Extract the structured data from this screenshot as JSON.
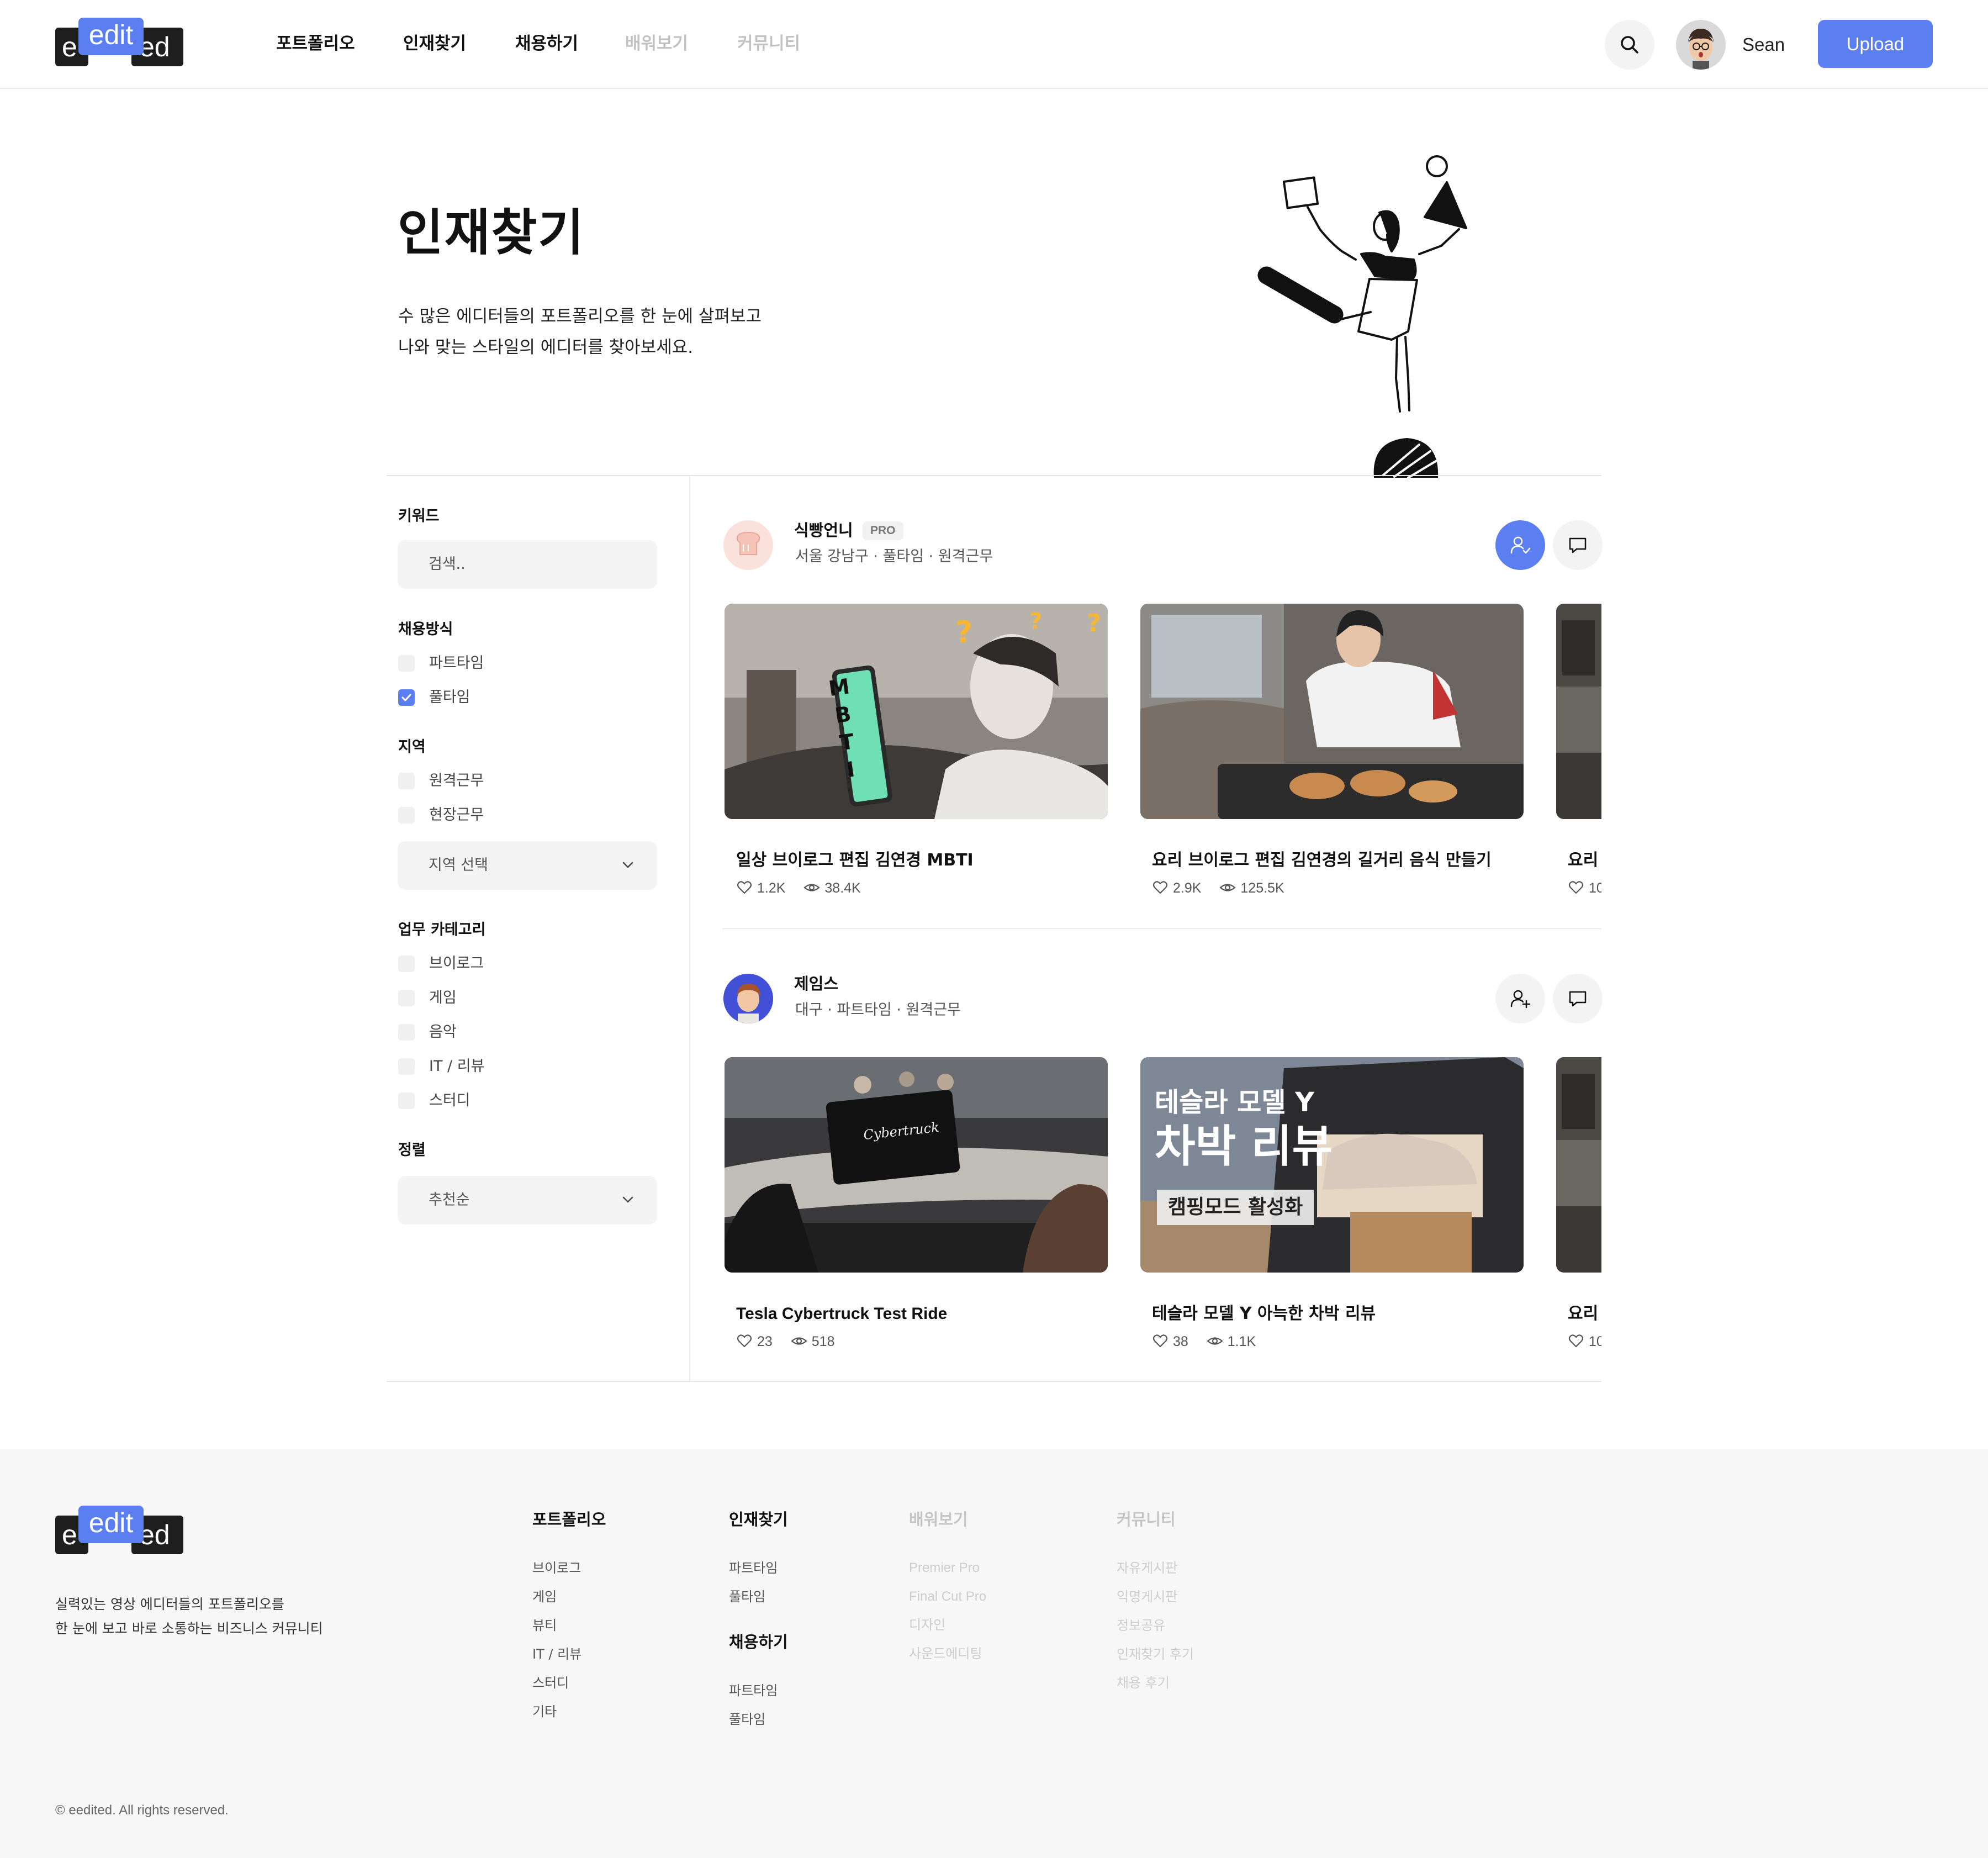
{
  "brand": {
    "logo_left": "e",
    "logo_mid": "edit",
    "logo_right": "ed"
  },
  "nav": {
    "items": [
      {
        "label": "포트폴리오"
      },
      {
        "label": "인재찾기"
      },
      {
        "label": "채용하기"
      },
      {
        "label": "배워보기",
        "disabled": true
      },
      {
        "label": "커뮤니티",
        "disabled": true
      }
    ]
  },
  "header": {
    "search_icon": "search-icon",
    "user_name": "Sean",
    "upload_label": "Upload"
  },
  "hero": {
    "title": "인재찾기",
    "desc_line1": "수 많은 에디터들의 포트폴리오를 한 눈에 살펴보고",
    "desc_line2": "나와 맞는 스타일의 에디터를 찾아보세요."
  },
  "filters": {
    "keyword_label": "키워드",
    "search_placeholder": "검색..",
    "hire_type_label": "채용방식",
    "hire_types": [
      {
        "label": "파트타임",
        "checked": false
      },
      {
        "label": "풀타임",
        "checked": true
      }
    ],
    "region_label": "지역",
    "regions": [
      {
        "label": "원격근무",
        "checked": false
      },
      {
        "label": "현장근무",
        "checked": false
      }
    ],
    "region_select": "지역 선택",
    "category_label": "업무 카테고리",
    "categories": [
      {
        "label": "브이로그",
        "checked": false
      },
      {
        "label": "게임",
        "checked": false
      },
      {
        "label": "음악",
        "checked": false
      },
      {
        "label": "IT / 리뷰",
        "checked": false
      },
      {
        "label": "스터디",
        "checked": false
      }
    ],
    "sort_label": "정렬",
    "sort_select": "추천순"
  },
  "editors": [
    {
      "name": "식빵언니",
      "badge": "PRO",
      "meta": "서울 강남구 · 풀타임 · 원격근무",
      "followed": true,
      "videos": [
        {
          "title": "일상 브이로그 편집 김연경 MBTI",
          "likes": "1.2K",
          "views": "38.4K",
          "overlay": "MBTI"
        },
        {
          "title": "요리 브이로그 편집 김연경의 길거리 음식 만들기",
          "likes": "2.9K",
          "views": "125.5K"
        },
        {
          "title": "요리",
          "likes": "10"
        }
      ]
    },
    {
      "name": "제임스",
      "meta": "대구 · 파트타임 · 원격근무",
      "followed": false,
      "videos": [
        {
          "title": "Tesla Cybertruck Test Ride",
          "likes": "23",
          "views": "518",
          "overlay": "Cybertruck"
        },
        {
          "title": "테슬라 모델 Y 아늑한 차박 리뷰",
          "likes": "38",
          "views": "1.1K",
          "overlay_line1": "테슬라 모델 Y",
          "overlay_line2": "차박 리뷰",
          "overlay_line3": "캠핑모드 활성화"
        },
        {
          "title": "요리",
          "likes": "10"
        }
      ]
    }
  ],
  "footer": {
    "tagline_line1": "실력있는 영상 에디터들의 포트폴리오를",
    "tagline_line2": "한 눈에 보고 바로 소통하는 비즈니스 커뮤니티",
    "columns": [
      {
        "heading": "포트폴리오",
        "links": [
          "브이로그",
          "게임",
          "뷰티",
          "IT / 리뷰",
          "스터디",
          "기타"
        ]
      },
      {
        "heading": "인재찾기",
        "links": [
          "파트타임",
          "풀타임"
        ]
      },
      {
        "heading": "채용하기",
        "links": [
          "파트타임",
          "풀타임"
        ]
      },
      {
        "heading": "배워보기",
        "links": [
          "Premier Pro",
          "Final Cut Pro",
          "디자인",
          "사운드에디팅"
        ]
      },
      {
        "heading": "커뮤니티",
        "links": [
          "자유게시판",
          "익명게시판",
          "정보공유",
          "인재찾기 후기",
          "채용 후기"
        ]
      }
    ],
    "copyright": "© eedited. All rights reserved."
  },
  "colors": {
    "accent": "#5b7ff1",
    "text": "#111111",
    "muted": "#c2c2c2",
    "footer_bg": "#f7f7f7"
  }
}
